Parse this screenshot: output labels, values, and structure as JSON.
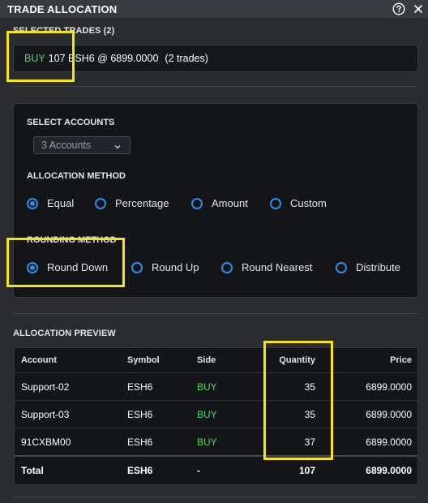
{
  "window": {
    "title": "TRADE ALLOCATION",
    "help_icon": "help-circle-icon",
    "close_icon": "close-icon"
  },
  "selected_trades": {
    "label": "SELECTED TRADES (2)",
    "side": "BUY",
    "details": "107 ESH6 @ 6899.0000",
    "count_text": "(2 trades)"
  },
  "accounts": {
    "label": "SELECT ACCOUNTS",
    "selected": "3 Accounts"
  },
  "allocation_method": {
    "label": "ALLOCATION METHOD",
    "options": [
      "Equal",
      "Percentage",
      "Amount",
      "Custom"
    ],
    "selected": "Equal"
  },
  "rounding_method": {
    "label": "ROUNDING METHOD",
    "options": [
      "Round Down",
      "Round Up",
      "Round Nearest",
      "Distribute"
    ],
    "selected": "Round Down"
  },
  "preview": {
    "label": "ALLOCATION PREVIEW",
    "columns": [
      "Account",
      "Symbol",
      "Side",
      "Quantity",
      "Price"
    ],
    "rows": [
      [
        "Support-02",
        "ESH6",
        "BUY",
        "35",
        "6899.0000"
      ],
      [
        "Support-03",
        "ESH6",
        "BUY",
        "35",
        "6899.0000"
      ],
      [
        "91CXBM00",
        "ESH6",
        "BUY",
        "37",
        "6899.0000"
      ]
    ],
    "total": [
      "Total",
      "ESH6",
      "-",
      "107",
      "6899.0000"
    ]
  },
  "colors": {
    "buy": "#4ed964",
    "accent": "#2c8ee8",
    "highlight": "#f5e611"
  }
}
